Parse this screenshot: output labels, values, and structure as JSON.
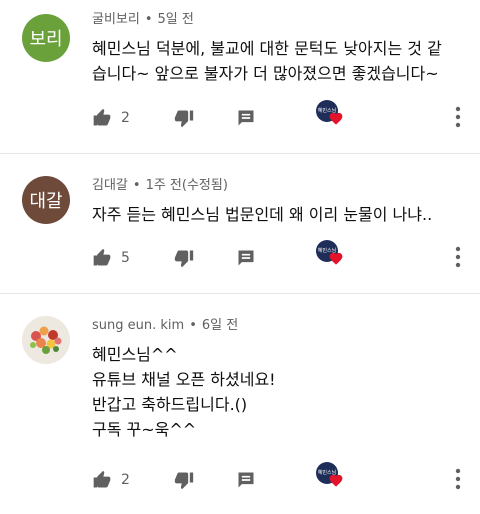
{
  "comments": [
    {
      "avatar_text": "보리",
      "avatar_color": "#6aa13b",
      "author": "굴비보리",
      "time": "5일 전",
      "edited": "",
      "lines": [
        "혜민스님 덕분에, 불교에 대한 문턱도 낮아지는 것 같",
        "습니다~ 앞으로 불자가 더 많아졌으면 좋겠습니다~"
      ],
      "likes": "2"
    },
    {
      "avatar_text": "대갈",
      "avatar_color": "#6d4a3a",
      "author": "김대갈",
      "time": "1주 전",
      "edited": "(수정됨)",
      "lines": [
        "자주 듣는 혜민스님 법문인데 왜 이리 눈물이 나냐.."
      ],
      "likes": "5"
    },
    {
      "avatar_text": "",
      "avatar_color": "#e9e4dd",
      "author": "sung eun. kim",
      "time": "6일 전",
      "edited": "",
      "lines": [
        "혜민스님^^",
        "유튜브 채널 오픈 하셨네요!",
        "반갑고 축하드립니다.()",
        "구독 꾸~욱^^"
      ],
      "likes": "2"
    }
  ],
  "creator_badge_text": "혜민스님",
  "icons": {
    "like": "thumb-up-icon",
    "dislike": "thumb-down-icon",
    "reply": "reply-icon",
    "heart": "creator-heart-icon",
    "more": "more-vert-icon"
  },
  "colors": {
    "heart": "#e3132c",
    "icon": "#606060",
    "text": "#0f0f0f",
    "meta": "#606060"
  }
}
